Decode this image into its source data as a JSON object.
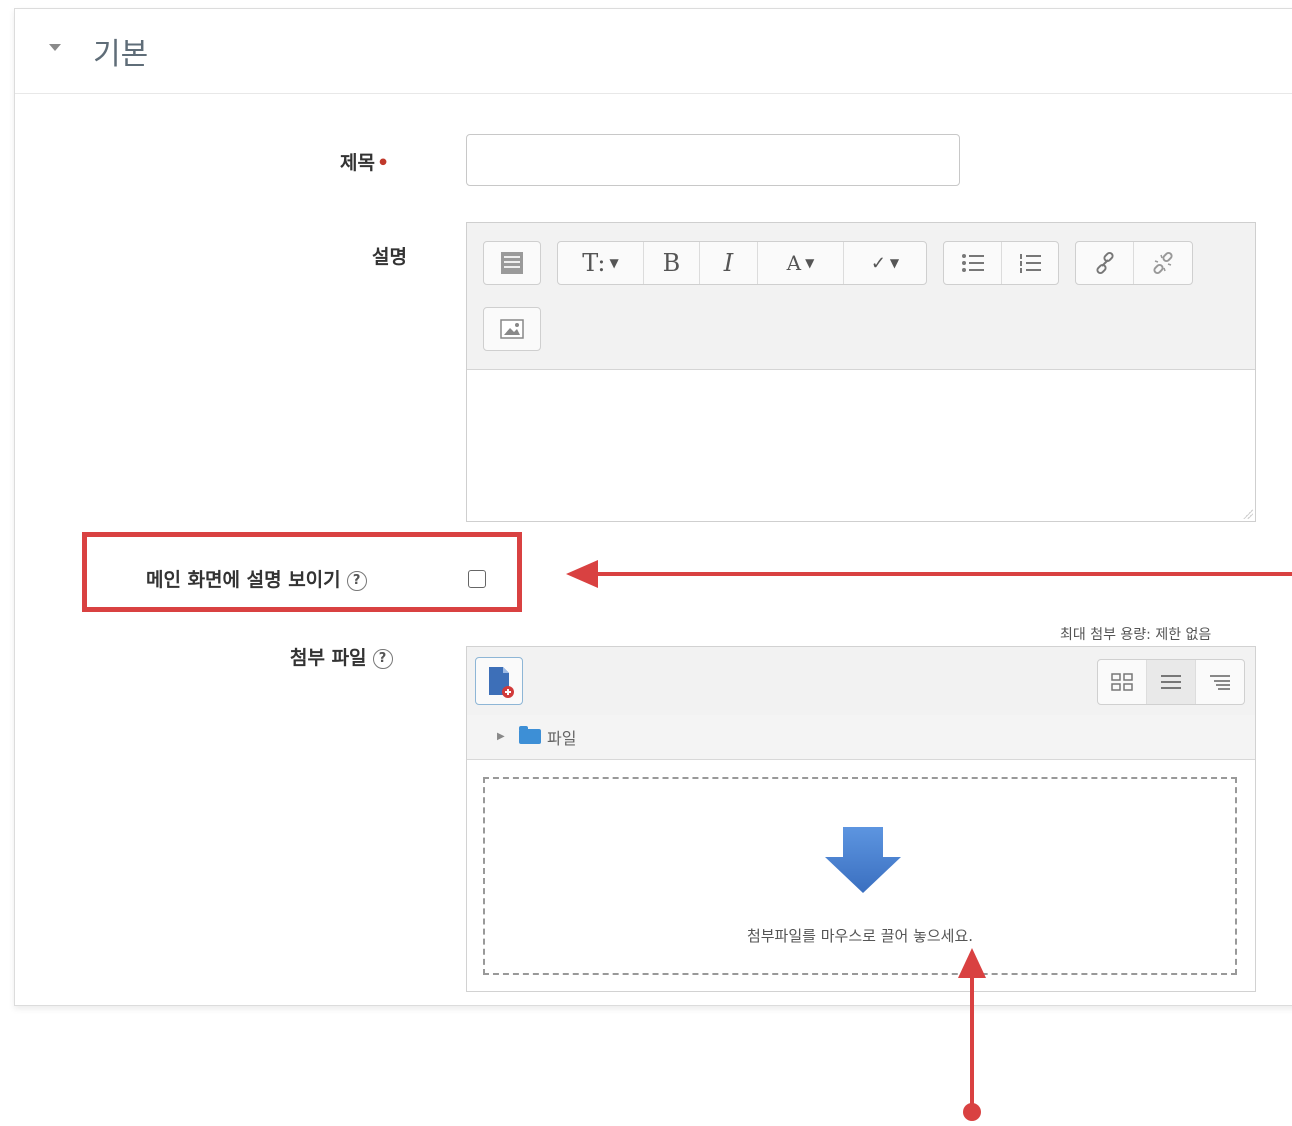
{
  "section": {
    "title": "기본"
  },
  "fields": {
    "title_label": "제목",
    "title_required_marker": "•",
    "title_value": "",
    "description_label": "설명",
    "show_description_label": "메인 화면에 설명 보이기",
    "show_description_checked": false,
    "attachments_label": "첨부 파일",
    "help_glyph": "?"
  },
  "editor_toolbar": {
    "row1": [
      {
        "name": "show-more-buttons-icon"
      },
      {
        "name": "heading-icon",
        "label": "T:"
      },
      {
        "name": "bold-icon",
        "label": "B"
      },
      {
        "name": "italic-icon",
        "label": "I"
      },
      {
        "name": "text-color-icon",
        "label": "A"
      },
      {
        "name": "background-color-icon",
        "label": "✓"
      },
      {
        "name": "unordered-list-icon"
      },
      {
        "name": "ordered-list-icon"
      },
      {
        "name": "link-icon"
      },
      {
        "name": "unlink-icon"
      }
    ],
    "row2": [
      {
        "name": "insert-image-icon"
      }
    ]
  },
  "file_manager": {
    "max_size": "최대 첨부 용량: 제한 없음",
    "folder_label": "파일",
    "drop_text": "첨부파일를 마우스로 끌어 놓으세요.",
    "accent_color": "#3d8fd6"
  },
  "colors": {
    "annotation_red": "#d94141",
    "drop_arrow_blue": "#4a80d0",
    "required_red": "#c0392b"
  }
}
